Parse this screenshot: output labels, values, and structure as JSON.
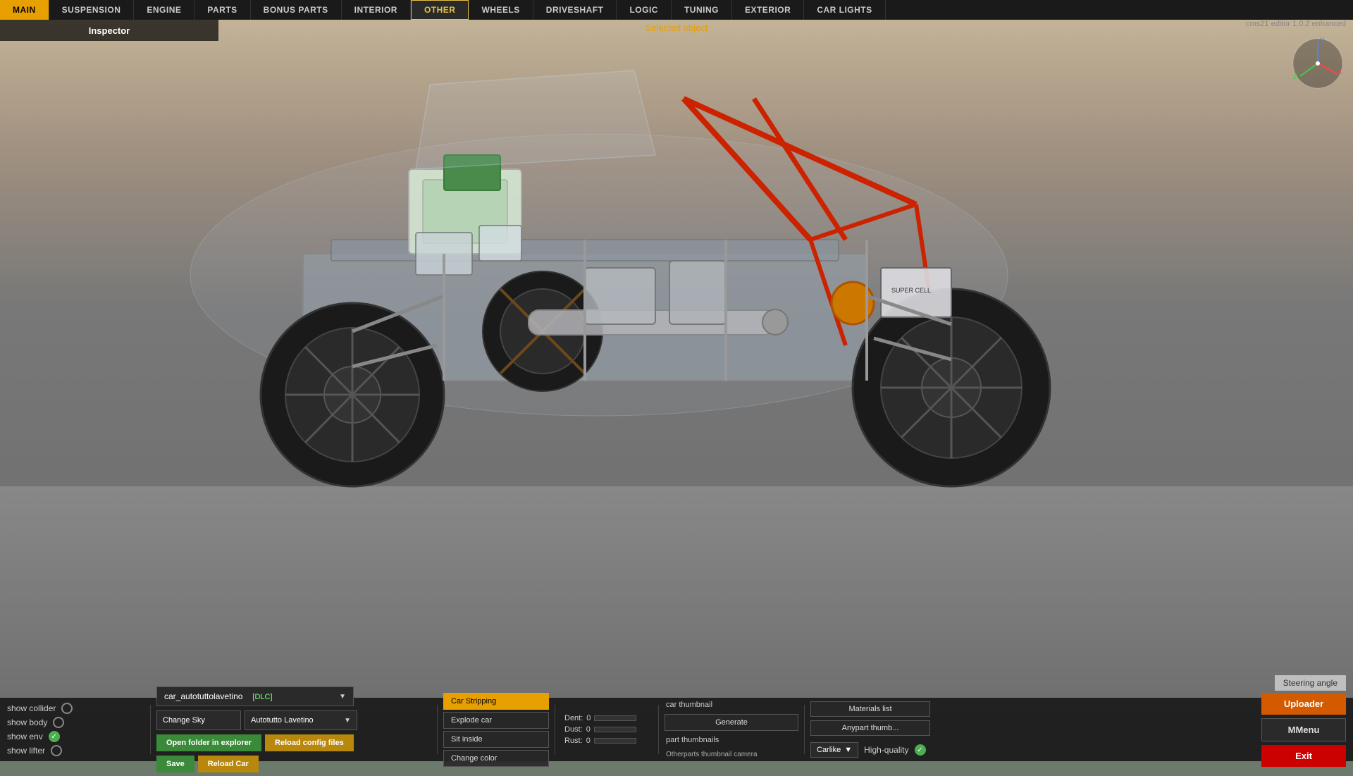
{
  "app": {
    "version": "cms21 editor 1.0.2 enhanced",
    "selected_object_label": "Selected object"
  },
  "nav": {
    "tabs": [
      {
        "label": "MAIN",
        "active": true,
        "id": "main"
      },
      {
        "label": "SUSPENSION",
        "active": false,
        "id": "suspension"
      },
      {
        "label": "ENGINE",
        "active": false,
        "id": "engine"
      },
      {
        "label": "PARTS",
        "active": false,
        "id": "parts"
      },
      {
        "label": "BONUS PARTS",
        "active": false,
        "id": "bonus-parts"
      },
      {
        "label": "INTERIOR",
        "active": false,
        "id": "interior"
      },
      {
        "label": "OTHER",
        "active": true,
        "id": "other"
      },
      {
        "label": "WHEELS",
        "active": false,
        "id": "wheels"
      },
      {
        "label": "DRIVESHAFT",
        "active": false,
        "id": "driveshaft"
      },
      {
        "label": "LOGIC",
        "active": false,
        "id": "logic"
      },
      {
        "label": "TUNING",
        "active": false,
        "id": "tuning"
      },
      {
        "label": "EXTERIOR",
        "active": false,
        "id": "exterior"
      },
      {
        "label": "CAR LIGHTS",
        "active": false,
        "id": "car-lights"
      }
    ]
  },
  "inspector": {
    "label": "Inspector"
  },
  "bottom_bar": {
    "checkboxes": [
      {
        "label": "show collider",
        "checked": false,
        "id": "show-collider"
      },
      {
        "label": "show body",
        "checked": false,
        "id": "show-body"
      },
      {
        "label": "show env",
        "checked": true,
        "id": "show-env"
      },
      {
        "label": "show lifter",
        "checked": false,
        "id": "show-lifter"
      }
    ],
    "car_selector": {
      "value": "car_autotuttolavetino  [DLC]",
      "dlc_label": "[DLC]",
      "arrow": "▼"
    },
    "sky_selector": {
      "label": "Change Sky",
      "value": "Autotutto Lavetino",
      "arrow": "▼"
    },
    "context_buttons": [
      {
        "label": "Car Stripping",
        "highlighted": true,
        "id": "car-stripping"
      },
      {
        "label": "Explode car",
        "highlighted": false,
        "id": "explode-car"
      },
      {
        "label": "Sit inside",
        "highlighted": false,
        "id": "sit-inside"
      },
      {
        "label": "Change color",
        "highlighted": false,
        "id": "change-color"
      }
    ],
    "stats": [
      {
        "label": "Dent:",
        "value": "0",
        "id": "dent"
      },
      {
        "label": "Dust:",
        "value": "0",
        "id": "dust"
      },
      {
        "label": "Rust:",
        "value": "0",
        "id": "rust"
      }
    ],
    "thumbnail": {
      "label": "car thumbnail",
      "generate_label": "Generate",
      "part_thumbnails_label": "part thumbnails",
      "otherparts_camera_label": "Otherparts thumbnail camera"
    },
    "materials_list_label": "Materials list",
    "anypart_thumb_label": "Anypart thumb...",
    "quality": {
      "label": "High-quality",
      "dropdown_value": "Carlike",
      "arrow": "▼"
    },
    "buttons": {
      "open_folder": "Open folder in explorer",
      "reload_config": "Reload config files",
      "save": "Save",
      "reload_car": "Reload Car"
    },
    "right_buttons": {
      "uploader": "Uploader",
      "mmenu": "MMenu",
      "exit": "Exit"
    },
    "steering_angle": "Steering angle"
  }
}
